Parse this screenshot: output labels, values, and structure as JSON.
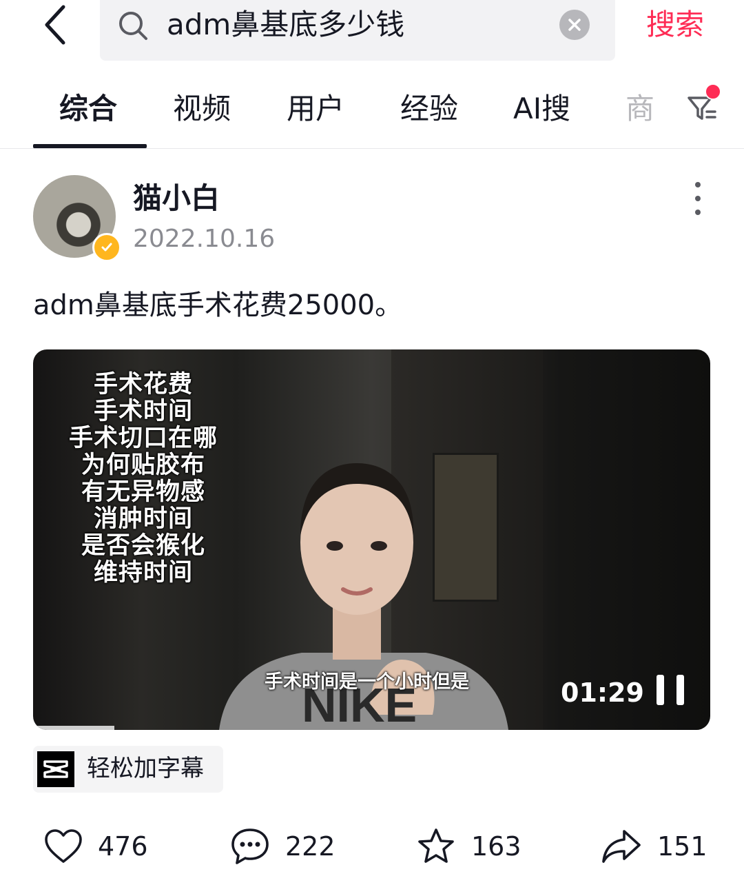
{
  "search": {
    "query": "adm鼻基底多少钱",
    "submit_label": "搜索"
  },
  "tabs": [
    {
      "label": "综合",
      "active": true
    },
    {
      "label": "视频"
    },
    {
      "label": "用户"
    },
    {
      "label": "经验"
    },
    {
      "label": "AI搜"
    },
    {
      "label": "商"
    }
  ],
  "post": {
    "author": "猫小白",
    "date": "2022.10.16",
    "caption": "adm鼻基底手术花费25000。",
    "video": {
      "overlay_lines": [
        "手术花费",
        "手术时间",
        "手术切口在哪",
        "为何贴胶布",
        "有无异物感",
        "消肿时间",
        "是否会猴化",
        "维持时间"
      ],
      "subtitle": "手术时间是一个小时但是",
      "time": "01:29",
      "progress": 0.12
    },
    "tool_chip": {
      "label": "轻松加字幕",
      "icon": "capcut-icon"
    },
    "stats": {
      "likes": "476",
      "comments": "222",
      "favorites": "163",
      "shares": "151"
    }
  },
  "colors": {
    "accent": "#fe2c55",
    "verified": "#ffb61e"
  }
}
